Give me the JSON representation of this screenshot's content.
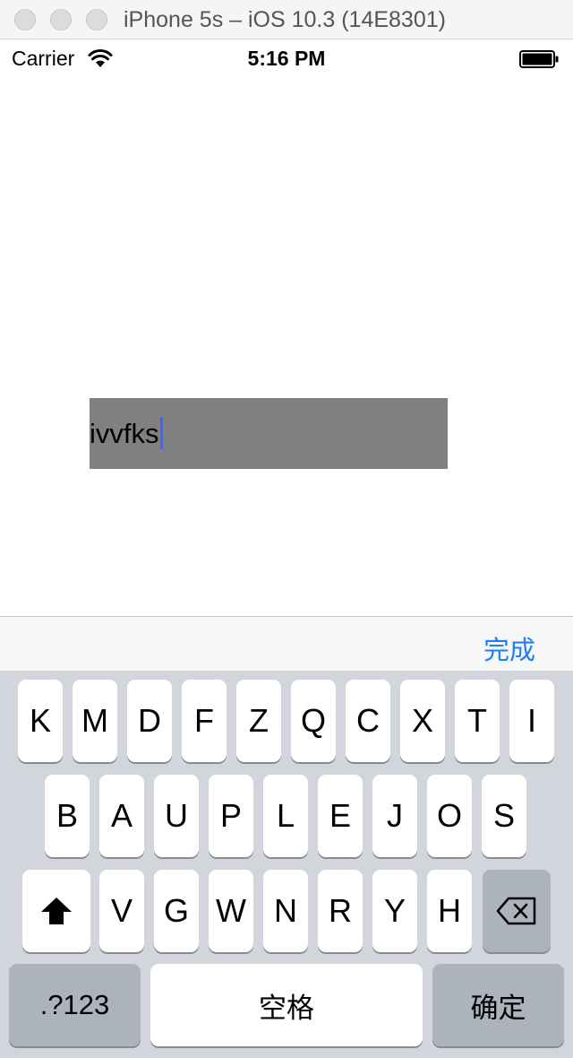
{
  "window": {
    "title": "iPhone 5s – iOS 10.3 (14E8301)"
  },
  "status_bar": {
    "carrier": "Carrier",
    "time": "5:16 PM"
  },
  "text_field": {
    "value": "ivvfks"
  },
  "toolbar": {
    "done_label": "完成"
  },
  "keyboard": {
    "row1": [
      "K",
      "M",
      "D",
      "F",
      "Z",
      "Q",
      "C",
      "X",
      "T",
      "I"
    ],
    "row2": [
      "B",
      "A",
      "U",
      "P",
      "L",
      "E",
      "J",
      "O",
      "S"
    ],
    "row3": [
      "V",
      "G",
      "W",
      "N",
      "R",
      "Y",
      "H"
    ],
    "numbers_label": ".?123",
    "space_label": "空格",
    "return_label": "确定"
  },
  "colors": {
    "accent": "#1f7df7",
    "caret": "#3a67ff",
    "text_field_bg": "#808080",
    "keyboard_bg": "#d2d5db"
  }
}
